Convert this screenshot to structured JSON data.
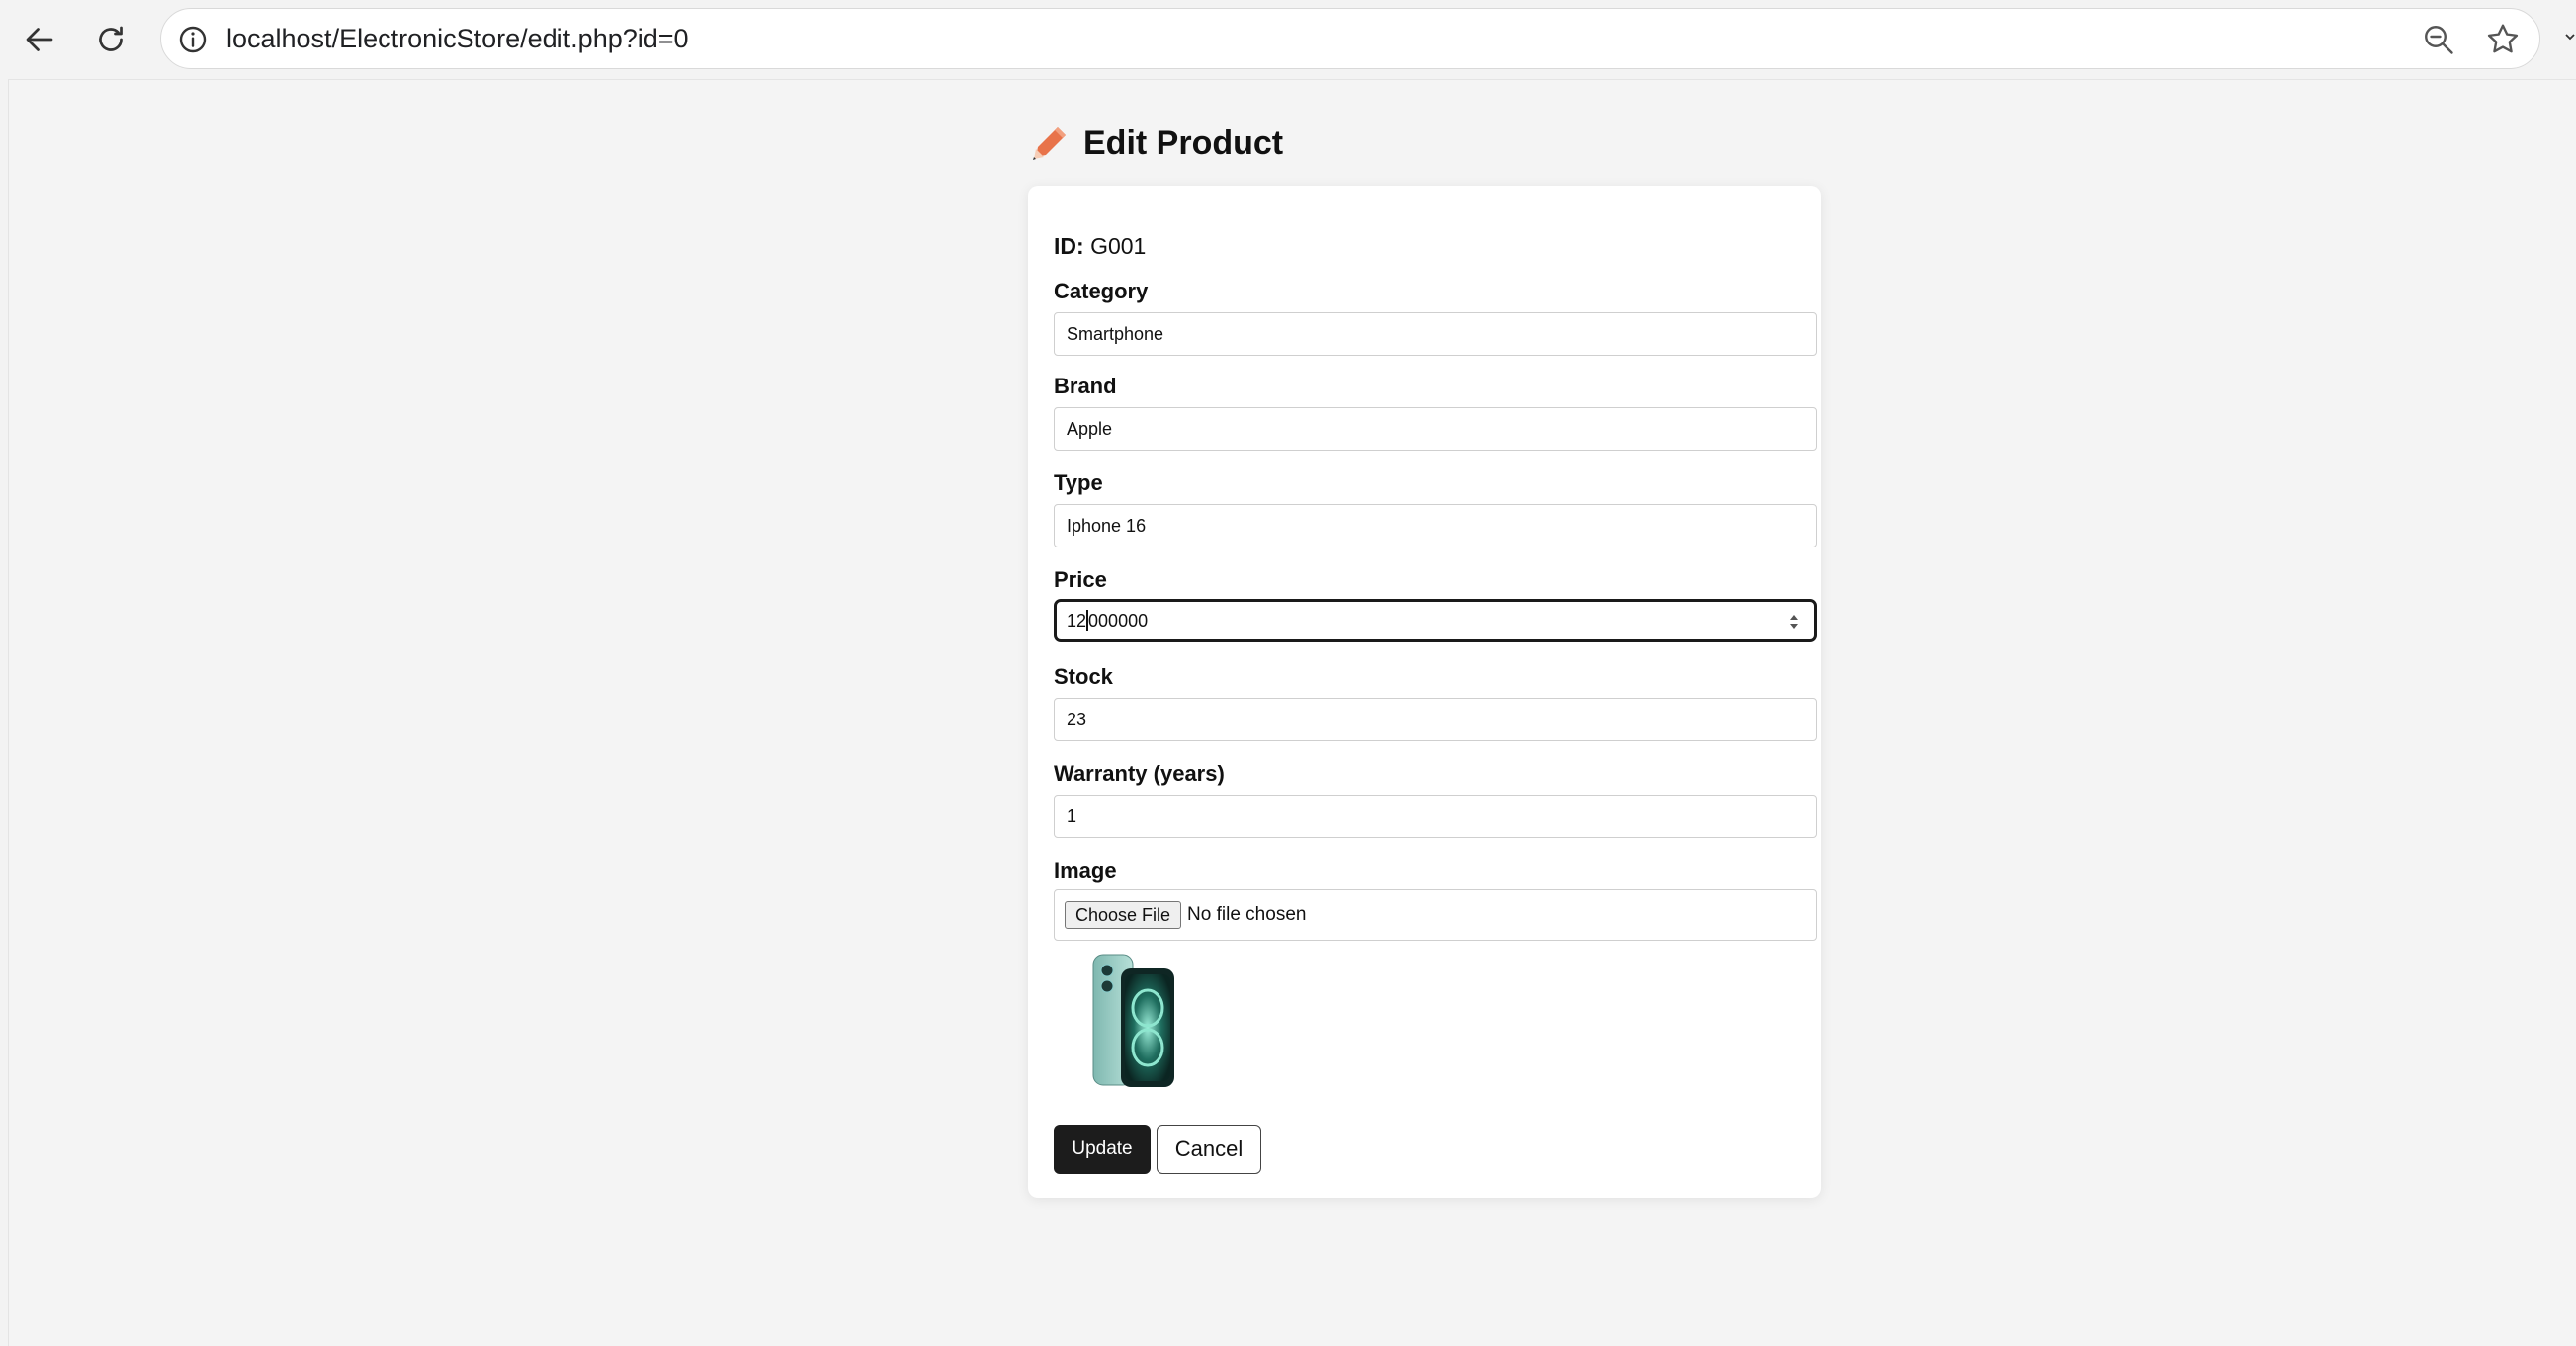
{
  "browser": {
    "url": "localhost/ElectronicStore/edit.php?id=0"
  },
  "page": {
    "title": "Edit Product",
    "title_icon": "pencil-icon"
  },
  "form": {
    "id_label": "ID:",
    "id_value": "G001",
    "category": {
      "label": "Category",
      "value": "Smartphone"
    },
    "brand": {
      "label": "Brand",
      "value": "Apple"
    },
    "type": {
      "label": "Type",
      "value": "Iphone 16"
    },
    "price": {
      "label": "Price",
      "value_before_caret": "12",
      "value_after_caret": "000000"
    },
    "stock": {
      "label": "Stock",
      "value": "23"
    },
    "warranty": {
      "label": "Warranty (years)",
      "value": "1"
    },
    "image": {
      "label": "Image",
      "choose_label": "Choose File",
      "status": "No file chosen"
    },
    "update_label": "Update",
    "cancel_label": "Cancel"
  },
  "colors": {
    "accent_dark": "#1c1c1c",
    "pencil": "#e8734a",
    "background": "#f4f4f4"
  }
}
